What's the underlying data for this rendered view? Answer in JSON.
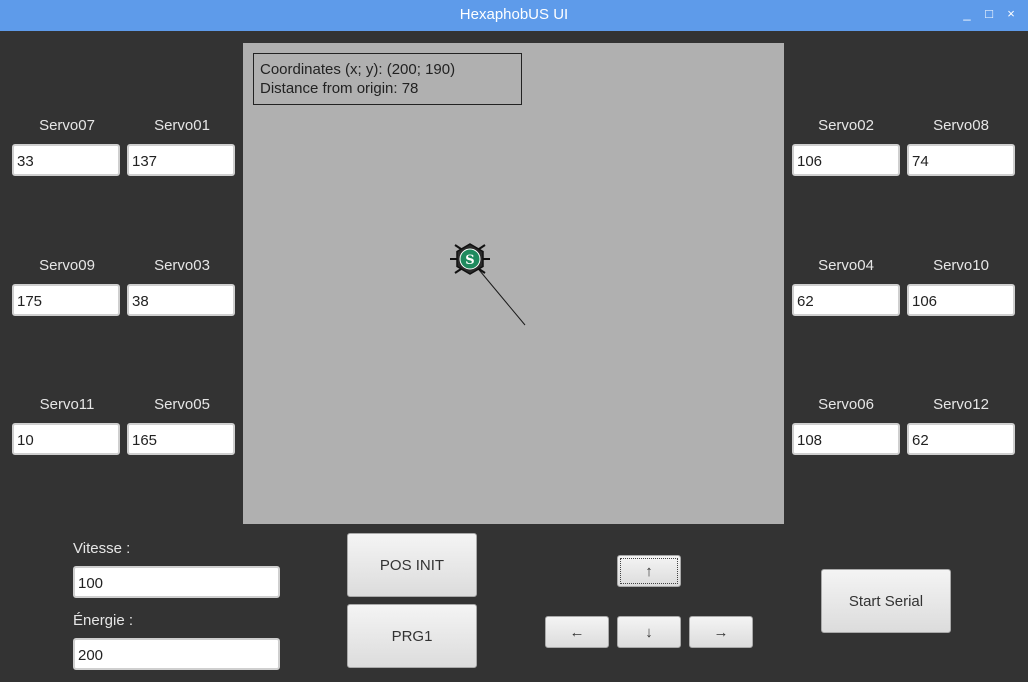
{
  "window": {
    "title": "HexaphobUS UI",
    "controls": {
      "minimize": "_",
      "maximize": "□",
      "close": "×"
    }
  },
  "canvas": {
    "coordinates_text": "Coordinates (x; y): (200; 190)",
    "distance_text": "Distance from origin: 78",
    "robot_icon": "hexapod-robot-icon",
    "robot_badge_color": "#1f8a5e"
  },
  "servos": {
    "left": [
      {
        "name": "Servo07",
        "value": "33"
      },
      {
        "name": "Servo01",
        "value": "137"
      },
      {
        "name": "Servo09",
        "value": "175"
      },
      {
        "name": "Servo03",
        "value": "38"
      },
      {
        "name": "Servo11",
        "value": "10"
      },
      {
        "name": "Servo05",
        "value": "165"
      }
    ],
    "right": [
      {
        "name": "Servo02",
        "value": "106"
      },
      {
        "name": "Servo08",
        "value": "74"
      },
      {
        "name": "Servo04",
        "value": "62"
      },
      {
        "name": "Servo10",
        "value": "106"
      },
      {
        "name": "Servo06",
        "value": "108"
      },
      {
        "name": "Servo12",
        "value": "62"
      }
    ]
  },
  "controls": {
    "speed_label": "Vitesse :",
    "speed_value": "100",
    "energy_label": "Énergie :",
    "energy_value": "200",
    "pos_init_label": "POS INIT",
    "prg1_label": "PRG1",
    "up_label": "↑",
    "left_label": "←",
    "down_label": "↓",
    "right_label": "→",
    "start_serial_label": "Start Serial"
  },
  "colors": {
    "titlebar": "#5e9bea",
    "background": "#333333",
    "canvas": "#b0b0b0"
  }
}
